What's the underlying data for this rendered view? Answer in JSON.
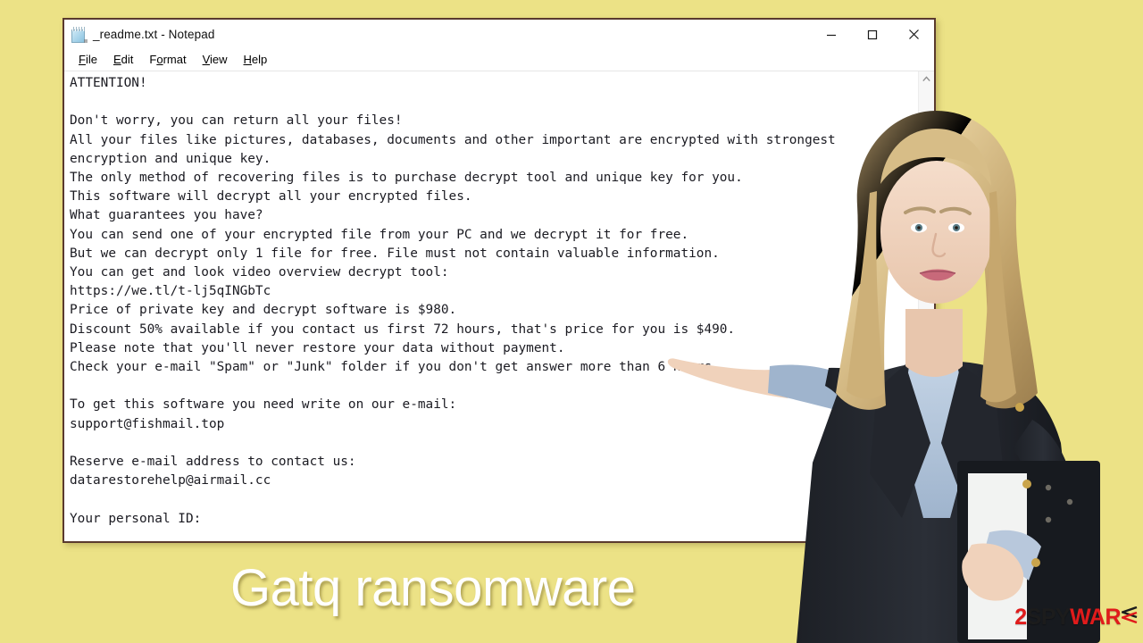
{
  "desktop": {
    "background_color": "#ece286"
  },
  "window": {
    "title": "_readme.txt - Notepad",
    "icon": "notepad-icon",
    "controls": {
      "minimize": "Minimize",
      "maximize": "Maximize",
      "close": "Close"
    },
    "menu": [
      {
        "label": "File",
        "accel": "F"
      },
      {
        "label": "Edit",
        "accel": "E"
      },
      {
        "label": "Format",
        "accel": "o"
      },
      {
        "label": "View",
        "accel": "V"
      },
      {
        "label": "Help",
        "accel": "H"
      }
    ],
    "scrollbar": {
      "up_arrow": "scroll-up-icon",
      "position": "top"
    },
    "document": {
      "filename": "_readme.txt",
      "lines": [
        "ATTENTION!",
        "",
        "Don't worry, you can return all your files!",
        "All your files like pictures, databases, documents and other important are encrypted with strongest",
        "encryption and unique key.",
        "The only method of recovering files is to purchase decrypt tool and unique key for you.",
        "This software will decrypt all your encrypted files.",
        "What guarantees you have?",
        "You can send one of your encrypted file from your PC and we decrypt it for free.",
        "But we can decrypt only 1 file for free. File must not contain valuable information.",
        "You can get and look video overview decrypt tool:",
        "https://we.tl/t-lj5qINGbTc",
        "Price of private key and decrypt software is $980.",
        "Discount 50% available if you contact us first 72 hours, that's price for you is $490.",
        "Please note that you'll never restore your data without payment.",
        "Check your e-mail \"Spam\" or \"Junk\" folder if you don't get answer more than 6 hours.",
        "",
        "To get this software you need write on our e-mail:",
        "support@fishmail.top",
        "",
        "Reserve e-mail address to contact us:",
        "datarestorehelp@airmail.cc",
        "",
        "Your personal ID:"
      ],
      "key_values": {
        "price_full": "$980",
        "price_discounted": "$490",
        "discount": "50%",
        "discount_window": "72 hours",
        "answer_wait": "6 hours",
        "free_decrypt_files": "1",
        "video_url": "https://we.tl/t-lj5qINGbTc",
        "email_primary": "support@fishmail.top",
        "email_reserve": "datarestorehelp@airmail.cc"
      }
    }
  },
  "caption": {
    "text": "Gatq ransomware",
    "color": "#ffffff"
  },
  "watermark": {
    "digit": "2",
    "middle": "SPY",
    "end": "WAR",
    "mark": "E",
    "colors": {
      "red": "#e01b1b",
      "dark": "#1c1c1c"
    }
  },
  "presenter": {
    "alt": "woman-presenter-photo"
  }
}
